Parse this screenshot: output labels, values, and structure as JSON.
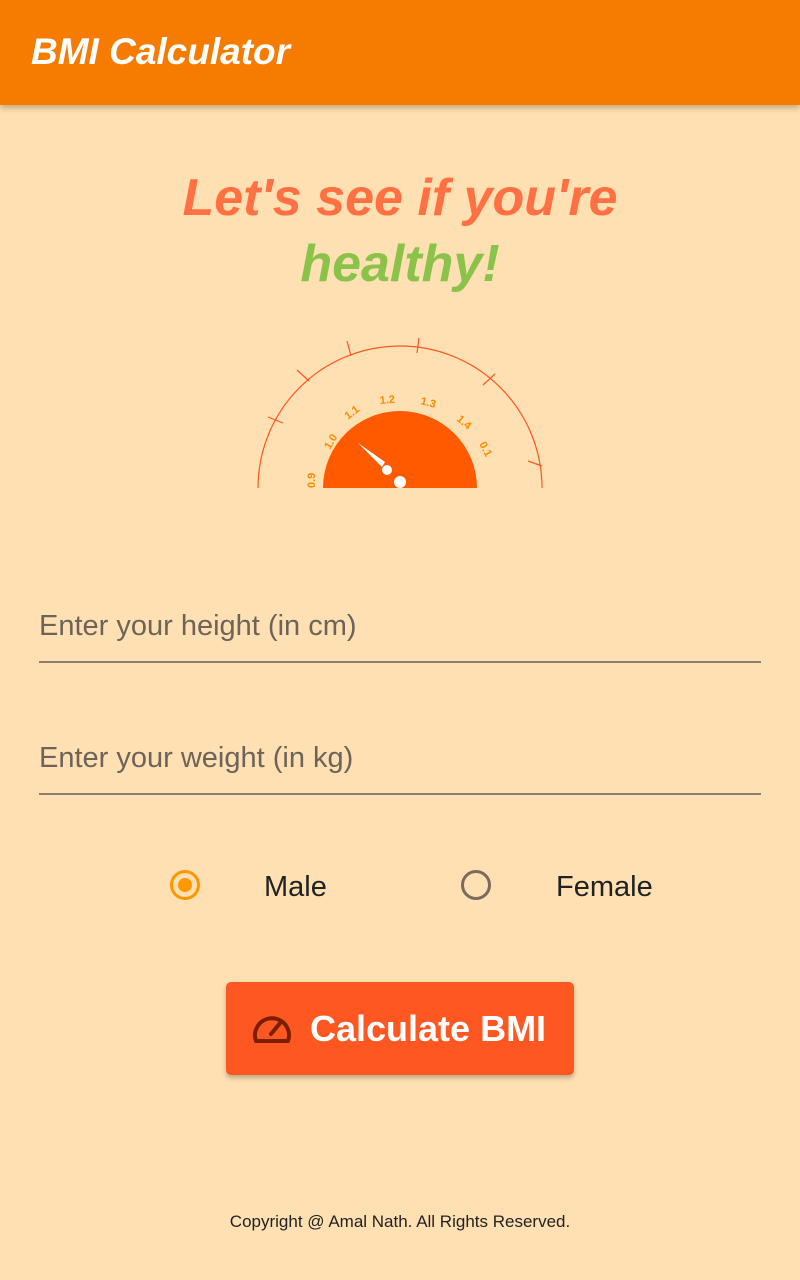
{
  "appbar": {
    "title": "BMI Calculator"
  },
  "headline": {
    "line1": "Let's see if you're",
    "line2": "healthy!"
  },
  "gauge": {
    "tick_labels": [
      "0.9",
      "1.0",
      "1.1",
      "1.2",
      "1.3",
      "1.4",
      "0.1"
    ],
    "arc_color": "#ff5722",
    "dial_color": "#ff5a00",
    "label_color": "#ff8a00"
  },
  "form": {
    "height_placeholder": "Enter your height (in cm)",
    "height_value": "",
    "weight_placeholder": "Enter your weight (in kg)",
    "weight_value": ""
  },
  "gender": {
    "options": [
      {
        "label": "Male",
        "selected": true
      },
      {
        "label": "Female",
        "selected": false
      }
    ]
  },
  "action": {
    "label": "Calculate BMI",
    "icon": "speedometer-icon"
  },
  "footer": {
    "copyright": "Copyright @ Amal Nath. All Rights Reserved."
  },
  "colors": {
    "appbar": "#f57c00",
    "background": "#ffe0b2",
    "headline_primary": "#ff7043",
    "headline_accent": "#8bc34a",
    "button": "#ff5722",
    "radio_selected": "#ff9800"
  }
}
